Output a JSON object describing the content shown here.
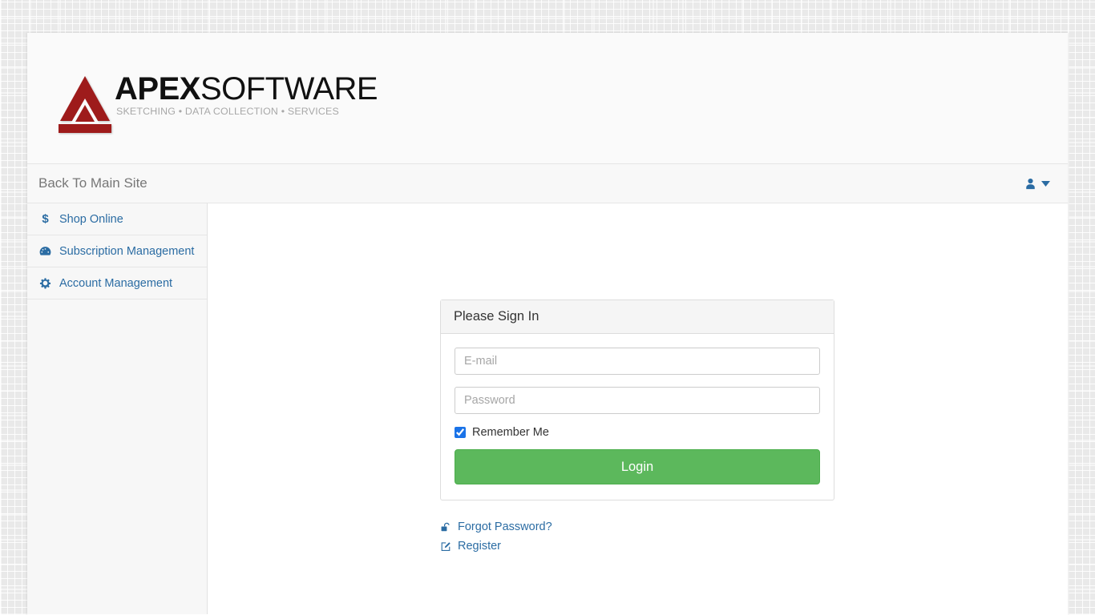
{
  "brand": {
    "name_bold": "APEX",
    "name_light": "SOFTWARE",
    "tagline": "SKETCHING • DATA COLLECTION • SERVICES",
    "logo_color": "#9e1b1b"
  },
  "topnav": {
    "back_label": "Back To Main Site",
    "user_icon": "user-icon",
    "caret_icon": "caret-down-icon",
    "accent_color": "#2b6ca3"
  },
  "sidebar": {
    "items": [
      {
        "label": "Shop Online",
        "icon": "dollar-icon"
      },
      {
        "label": "Subscription Management",
        "icon": "tachometer-icon"
      },
      {
        "label": "Account Management",
        "icon": "gear-icon"
      }
    ]
  },
  "login": {
    "title": "Please Sign In",
    "email": {
      "value": "",
      "placeholder": "E-mail"
    },
    "password": {
      "value": "",
      "placeholder": "Password"
    },
    "remember": {
      "label": "Remember Me",
      "checked": true
    },
    "submit_label": "Login",
    "submit_color": "#5cb85c"
  },
  "aux_links": [
    {
      "label": "Forgot Password?",
      "icon": "unlock-icon"
    },
    {
      "label": "Register",
      "icon": "edit-pencil-icon"
    }
  ]
}
